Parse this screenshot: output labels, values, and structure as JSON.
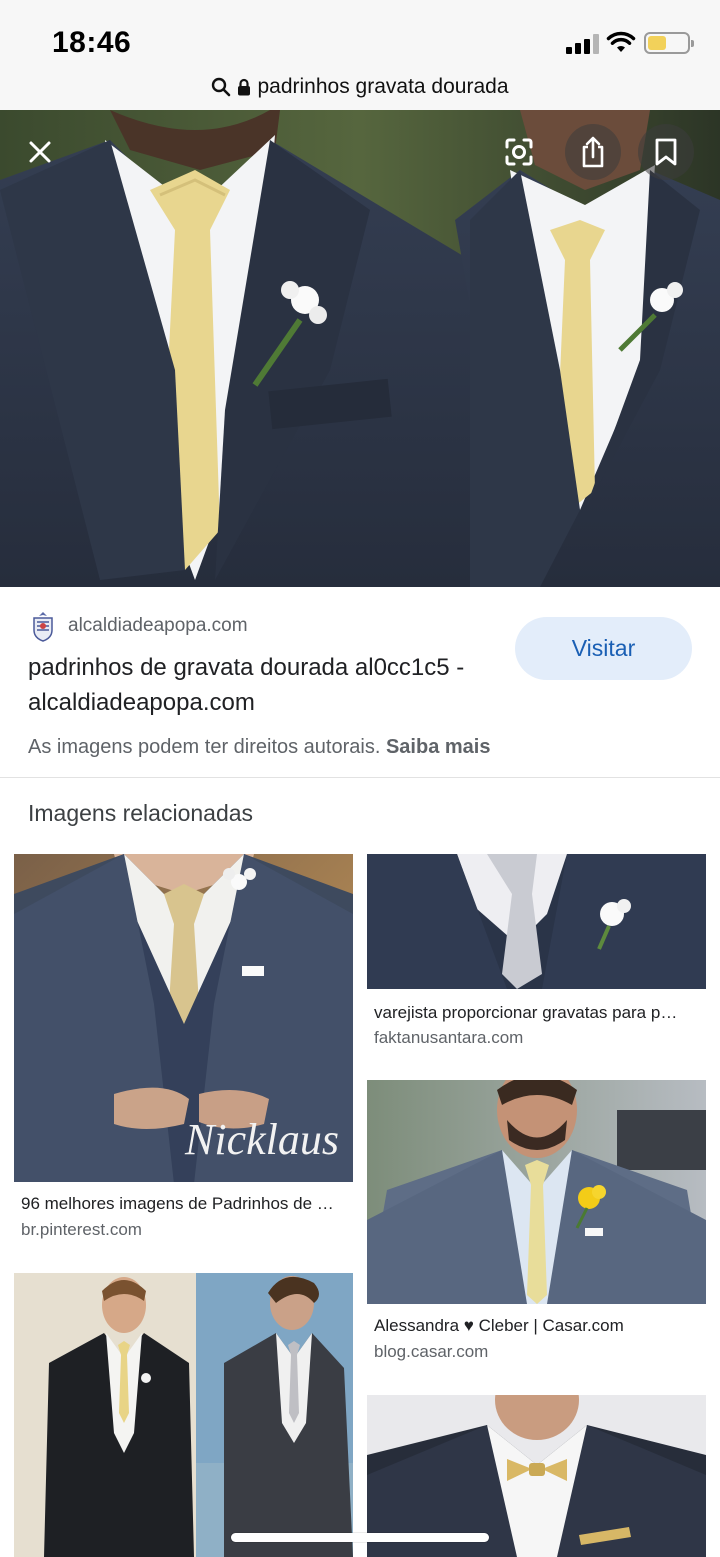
{
  "status_bar": {
    "time": "18:46",
    "signal_icon": "cellular-signal-icon",
    "wifi_icon": "wifi-icon",
    "battery_icon": "battery-icon",
    "battery_level": 0.45
  },
  "url_bar": {
    "query": "padrinhos gravata dourada",
    "search_icon": "search-icon",
    "lock_icon": "lock-icon"
  },
  "viewer": {
    "close_icon": "close-icon",
    "lens_icon": "lens-icon",
    "share_icon": "share-icon",
    "bookmark_icon": "bookmark-icon"
  },
  "result": {
    "source_domain": "alcaldiadeapopa.com",
    "title": "padrinhos de gravata dourada al0cc1c5 - alcaldiadeapopa.com",
    "visit_label": "Visitar",
    "copyright_text": "As imagens podem ter direitos autorais.",
    "learn_more": "Saiba mais"
  },
  "related": {
    "heading": "Imagens relacionadas",
    "items": [
      {
        "caption": "96 melhores imagens de Padrinhos de …",
        "source": "br.pinterest.com",
        "watermark": "Nicklaus"
      },
      {
        "caption": "varejista proporcionar gravatas para p…",
        "source": "faktanusantara.com"
      },
      {
        "caption": "Alessandra ♥ Cleber | Casar.com",
        "source": "blog.casar.com"
      },
      {
        "caption": "",
        "source": ""
      },
      {
        "caption": "",
        "source": ""
      }
    ]
  },
  "colors": {
    "accent": "#1a5fb4",
    "visit_bg": "#e3edfa",
    "suit_navy": "#2b3446",
    "tie_gold": "#e8d68f"
  }
}
